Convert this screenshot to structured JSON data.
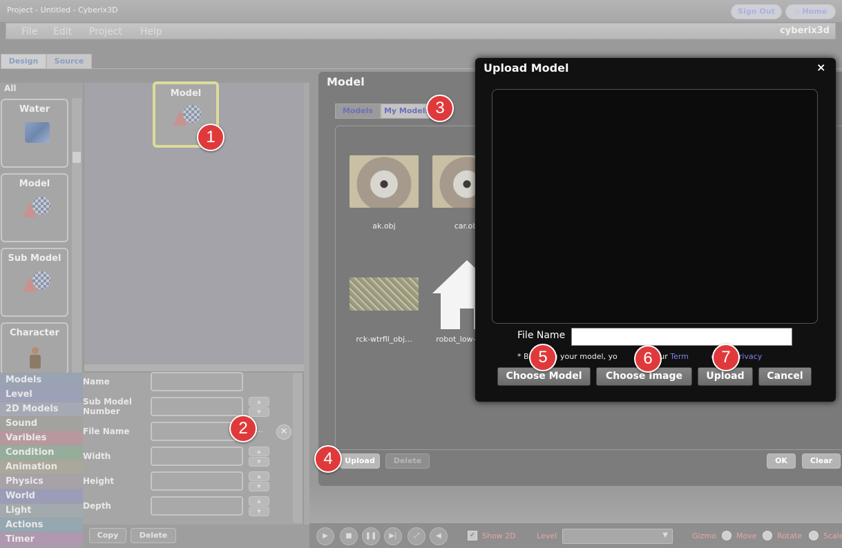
{
  "app": {
    "title": "Project - Untitled - Cyberix3D",
    "brand": "cyberix3d"
  },
  "auth": {
    "sign_out": "Sign Out",
    "home": "Home"
  },
  "menu": [
    "File",
    "Edit",
    "Project",
    "Help"
  ],
  "editor_tabs": [
    "Design",
    "Source"
  ],
  "palette": {
    "all_label": "All",
    "cards": [
      "Water",
      "Model",
      "Sub Model",
      "Character"
    ]
  },
  "canvas": {
    "selected_label": "Model"
  },
  "categories": [
    {
      "label": "Models",
      "color": "#9aa3b3"
    },
    {
      "label": "Level",
      "color": "#9da1b8"
    },
    {
      "label": "2D Models",
      "color": "#a5a9b3"
    },
    {
      "label": "Sound",
      "color": "#a3a39d"
    },
    {
      "label": "Varibles",
      "color": "#b7989e"
    },
    {
      "label": "Condition",
      "color": "#97ad9c"
    },
    {
      "label": "Animation",
      "color": "#aaa89a"
    },
    {
      "label": "Physics",
      "color": "#a8a2a8"
    },
    {
      "label": "World",
      "color": "#9b9cb8"
    },
    {
      "label": "Light",
      "color": "#a3aaad"
    },
    {
      "label": "Actions",
      "color": "#95a7b0"
    },
    {
      "label": "Timer",
      "color": "#af98b0"
    }
  ],
  "properties": {
    "name": "Name",
    "sub_model_number": "Sub Model Number",
    "file_name": "File Name",
    "width": "Width",
    "height": "Height",
    "depth": "Depth",
    "browse": "..."
  },
  "left_buttons": {
    "copy": "Copy",
    "delete": "Delete"
  },
  "model_dialog": {
    "title": "Model",
    "tabs": [
      "Models",
      "My Models"
    ],
    "items": [
      {
        "label": "ak.obj"
      },
      {
        "label": "car.obj"
      },
      {
        "label": "rck-wtrfll_obj..."
      },
      {
        "label": "robot_low-poly..."
      }
    ],
    "upload": "Upload",
    "delete": "Delete",
    "ok": "OK",
    "clear": "Clear"
  },
  "upload_dialog": {
    "title": "Upload Model",
    "close": "×",
    "file_name_label": "File Name",
    "file_name_value": "",
    "notice_prefix": "* B",
    "notice_mid1": "ding your model, yo",
    "notice_mid2": "e to our ",
    "notice_link1": "Term",
    "notice_link2": "e and Privacy",
    "buttons": {
      "choose_model": "Choose Model",
      "choose_image": "Choose Image",
      "upload": "Upload",
      "cancel": "Cancel"
    }
  },
  "badges": [
    "1",
    "2",
    "3",
    "4",
    "5",
    "6",
    "7"
  ],
  "toolbar": {
    "show_2d": "Show 2D",
    "level": "Level",
    "gizmo": "Gizmo",
    "move": "Move",
    "rotate": "Rotate",
    "scale": "Scale"
  }
}
